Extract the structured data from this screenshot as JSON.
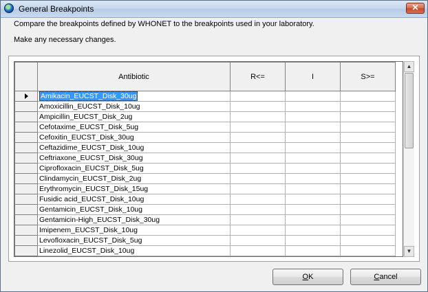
{
  "window": {
    "title": "General Breakpoints",
    "close_label": "✕"
  },
  "instructions": {
    "line1": "Compare the breakpoints defined by WHONET to the breakpoints used in your laboratory.",
    "line2": "Make any necessary changes."
  },
  "grid": {
    "columns": [
      "Antibiotic",
      "R<=",
      "I",
      "S>="
    ],
    "selected_row": 0,
    "rows": [
      {
        "antibiotic": "Amikacin_EUCST_Disk_30ug",
        "r": "",
        "i": "",
        "s": ""
      },
      {
        "antibiotic": "Amoxicillin_EUCST_Disk_10ug",
        "r": "",
        "i": "",
        "s": ""
      },
      {
        "antibiotic": "Ampicillin_EUCST_Disk_2ug",
        "r": "",
        "i": "",
        "s": ""
      },
      {
        "antibiotic": "Cefotaxime_EUCST_Disk_5ug",
        "r": "",
        "i": "",
        "s": ""
      },
      {
        "antibiotic": "Cefoxitin_EUCST_Disk_30ug",
        "r": "",
        "i": "",
        "s": ""
      },
      {
        "antibiotic": "Ceftazidime_EUCST_Disk_10ug",
        "r": "",
        "i": "",
        "s": ""
      },
      {
        "antibiotic": "Ceftriaxone_EUCST_Disk_30ug",
        "r": "",
        "i": "",
        "s": ""
      },
      {
        "antibiotic": "Ciprofloxacin_EUCST_Disk_5ug",
        "r": "",
        "i": "",
        "s": ""
      },
      {
        "antibiotic": "Clindamycin_EUCST_Disk_2ug",
        "r": "",
        "i": "",
        "s": ""
      },
      {
        "antibiotic": "Erythromycin_EUCST_Disk_15ug",
        "r": "",
        "i": "",
        "s": ""
      },
      {
        "antibiotic": "Fusidic acid_EUCST_Disk_10ug",
        "r": "",
        "i": "",
        "s": ""
      },
      {
        "antibiotic": "Gentamicin_EUCST_Disk_10ug",
        "r": "",
        "i": "",
        "s": ""
      },
      {
        "antibiotic": "Gentamicin-High_EUCST_Disk_30ug",
        "r": "",
        "i": "",
        "s": ""
      },
      {
        "antibiotic": "Imipenem_EUCST_Disk_10ug",
        "r": "",
        "i": "",
        "s": ""
      },
      {
        "antibiotic": "Levofloxacin_EUCST_Disk_5ug",
        "r": "",
        "i": "",
        "s": ""
      },
      {
        "antibiotic": "Linezolid_EUCST_Disk_10ug",
        "r": "",
        "i": "",
        "s": ""
      },
      {
        "antibiotic": "",
        "r": "",
        "i": "",
        "s": ""
      }
    ]
  },
  "scrollbar": {
    "up_icon": "▲",
    "down_icon": "▼"
  },
  "buttons": {
    "ok_accel": "O",
    "ok_rest": "K",
    "cancel_accel": "C",
    "cancel_rest": "ancel"
  },
  "icons": {
    "app": "globe-icon",
    "row_indicator": "row-pointer-icon"
  }
}
